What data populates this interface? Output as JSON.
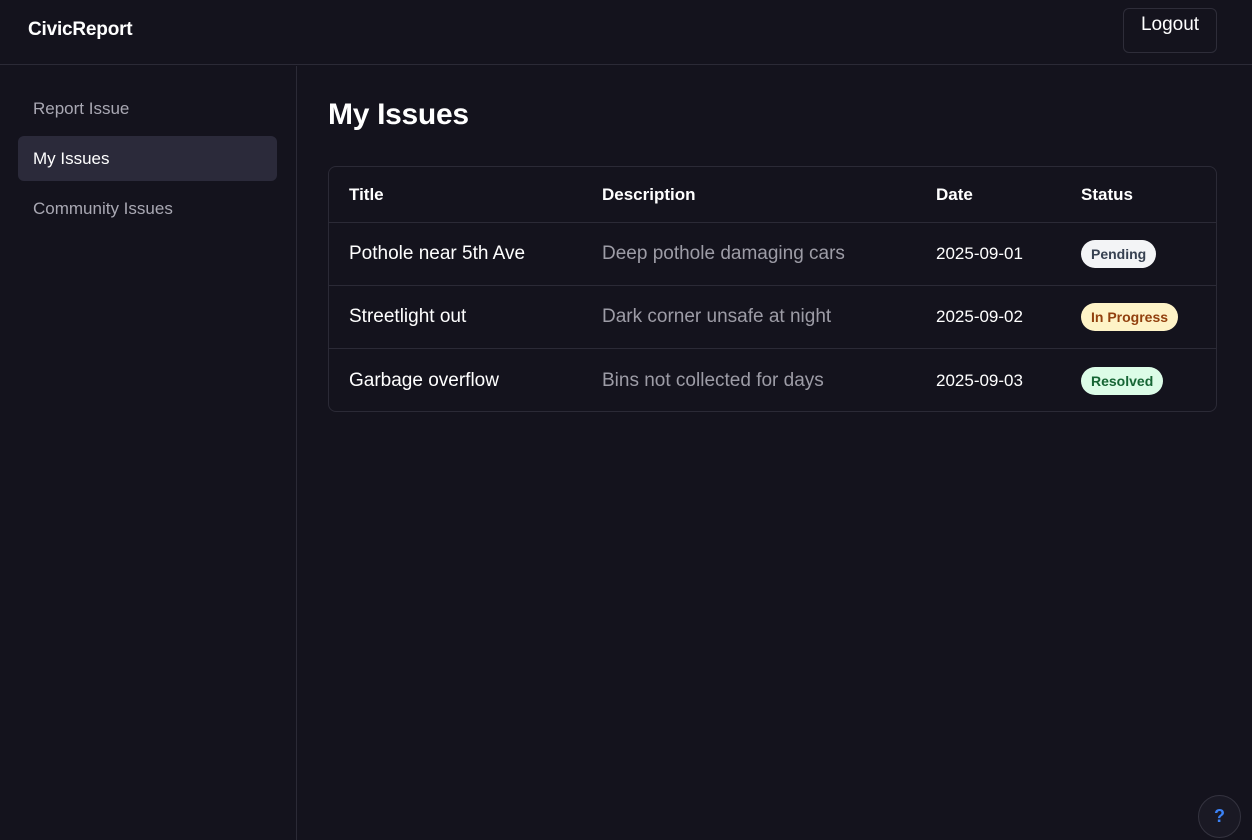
{
  "app": {
    "brand": "CivicReport",
    "logout_label": "Logout"
  },
  "sidebar": {
    "items": [
      {
        "label": "Report Issue",
        "active": false
      },
      {
        "label": "My Issues",
        "active": true
      },
      {
        "label": "Community Issues",
        "active": false
      }
    ]
  },
  "main": {
    "title": "My Issues",
    "table": {
      "headers": {
        "title": "Title",
        "description": "Description",
        "date": "Date",
        "status": "Status"
      },
      "rows": [
        {
          "title": "Pothole near 5th Ave",
          "description": "Deep pothole damaging cars",
          "date": "2025-09-01",
          "status": "Pending",
          "status_bg": "#f3f4f6",
          "status_fg": "#374151"
        },
        {
          "title": "Streetlight out",
          "description": "Dark corner unsafe at night",
          "date": "2025-09-02",
          "status": "In Progress",
          "status_bg": "#fef3c7",
          "status_fg": "#92400e"
        },
        {
          "title": "Garbage overflow",
          "description": "Bins not collected for days",
          "date": "2025-09-03",
          "status": "Resolved",
          "status_bg": "#dcfce7",
          "status_fg": "#166534"
        }
      ]
    }
  },
  "help": {
    "label": "?",
    "icon": "question-mark-icon",
    "color": "#3b82f6"
  },
  "colors": {
    "background": "#14131d",
    "active_nav": "#2b2a3a",
    "border": "#2b2a36"
  }
}
